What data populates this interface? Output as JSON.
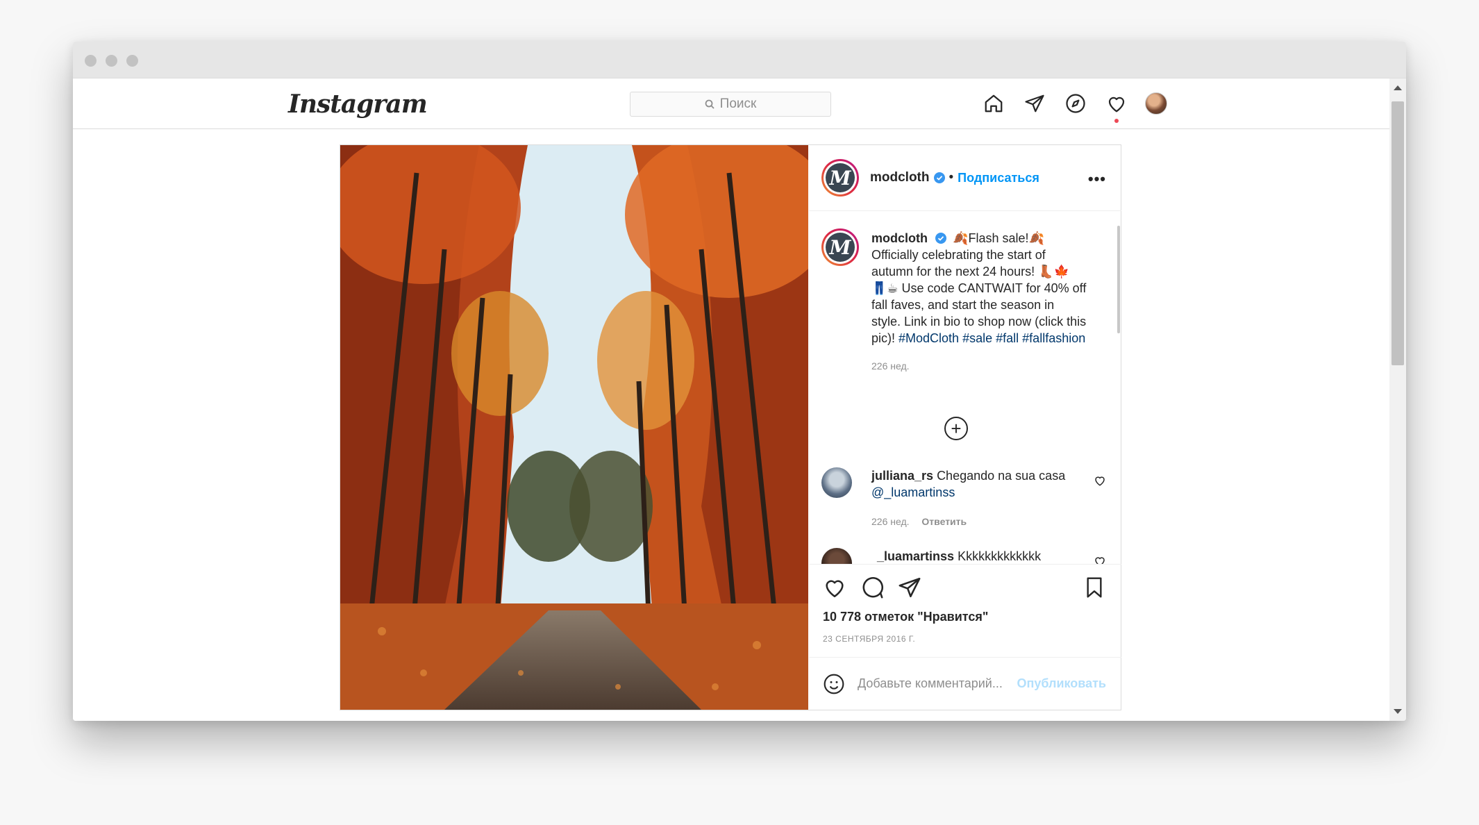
{
  "navbar": {
    "logo": "Instagram",
    "search_placeholder": "Поиск",
    "icons": [
      "home-icon",
      "direct-icon",
      "explore-icon",
      "activity-heart-icon",
      "profile-avatar"
    ]
  },
  "post": {
    "author": "modcloth",
    "follow_label": "Подписаться",
    "more_label": "•••",
    "caption": {
      "username": "modcloth",
      "text_before_tags": "🍂Flash sale!🍂 Officially celebrating the start of autumn for the next 24 hours! 👢🍁 👖☕ Use code CANTWAIT for 40% off fall faves, and start the season in style. Link in bio to shop now (click this pic)! ",
      "hashtags": [
        "#ModCloth",
        "#sale",
        "#fall",
        "#fallfashion"
      ],
      "time": "226 нед."
    },
    "load_more": "+",
    "comments": [
      {
        "username": "julliana_rs",
        "text": "Chegando na sua casa",
        "mention": "@_luamartinss",
        "time": "226 нед.",
        "reply_label": "Ответить"
      },
      {
        "username": "_luamartinss",
        "text": "Kkkkkkkkkkkkk"
      }
    ],
    "likes": "10 778 отметок \"Нравится\"",
    "date": "23 СЕНТЯБРЯ 2016 Г.",
    "add_comment_placeholder": "Добавьте комментарий...",
    "publish_label": "Опубликовать"
  },
  "colors": {
    "link_blue": "#0095f6",
    "hashtag_blue": "#00376b",
    "publish_disabled": "#b2dffc",
    "notification_red": "#ed4956"
  }
}
